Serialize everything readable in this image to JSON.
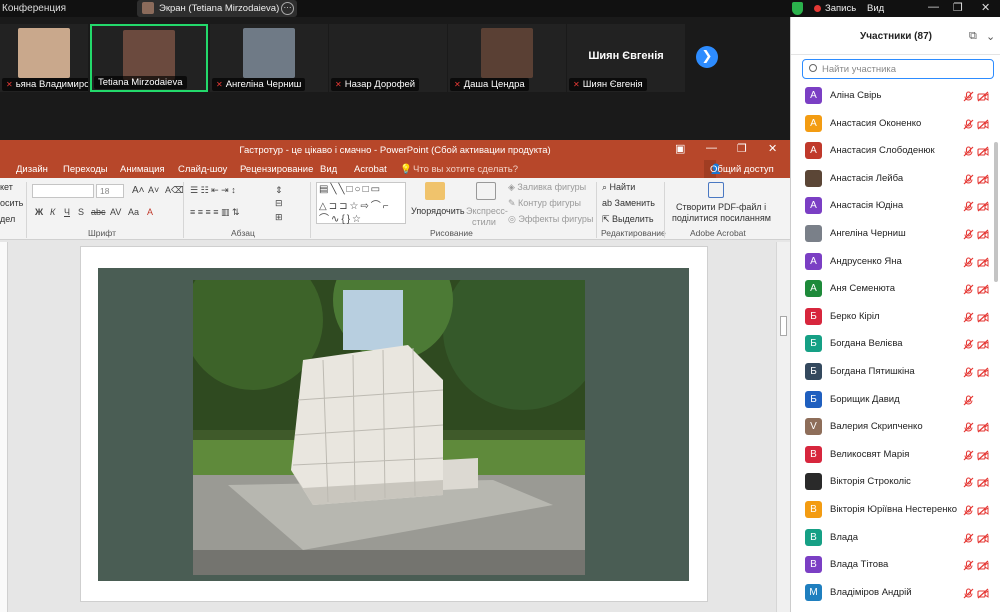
{
  "topbar": {
    "conference_label": "Конференция",
    "share_label": "Экран (Tetiana Mirzodaieva)",
    "record_label": "Запись",
    "view_label": "Вид"
  },
  "tiles": [
    {
      "name": "ьяна Владимировна",
      "photo_color": "#c9a88c"
    },
    {
      "name": "Tetiana Mirzodaieva",
      "photo_color": "#6b4a3e",
      "active": true
    },
    {
      "name": "Ангеліна Черниш",
      "photo_color": "#6f7a86"
    },
    {
      "name": "Назар Дорофей"
    },
    {
      "name": "Даша Цендра",
      "photo_color": "#5a4034"
    },
    {
      "name": "Шиян Євгенія",
      "display": "Шиян Євгенія"
    }
  ],
  "ppt": {
    "title": "Гастротур - це цікаво і смачно - PowerPoint (Сбой активации продукта)",
    "tabs": [
      "Дизайн",
      "Переходы",
      "Анимация",
      "Слайд-шоу",
      "Рецензирование",
      "Вид",
      "Acrobat"
    ],
    "tell_me": "Что вы хотите сделать?",
    "share": "Общий доступ",
    "groups": {
      "font": "Шрифт",
      "paragraph": "Абзац",
      "drawing": "Рисование",
      "editing": "Редактирование",
      "acrobat": "Adobe Acrobat"
    },
    "font_size": "18",
    "left_labels": [
      "кет",
      "осить",
      "дел"
    ],
    "arrange": "Упорядочить",
    "express": "Экспресс-",
    "styles": "стили",
    "shape_fill": "Заливка фигуры",
    "shape_outline": "Контур фигуры",
    "shape_effects": "Эффекты фигуры",
    "find": "Найти",
    "replace": "Заменить",
    "select": "Выделить",
    "pdf1": "Створити PDF-файл і",
    "pdf2": "поділитися посиланням"
  },
  "panel": {
    "title": "Участники (87)",
    "search_placeholder": "Найти участника",
    "participants": [
      {
        "initial": "А",
        "name": "Аліна Свірь",
        "color": "#7b3fc4"
      },
      {
        "initial": "А",
        "name": "Анастасия Оконенко",
        "color": "#f39c12"
      },
      {
        "initial": "А",
        "name": "Анастасия Слободенюк",
        "color": "#c0392b"
      },
      {
        "initial": "",
        "name": "Анастасія Лейба",
        "color": "#5b4636"
      },
      {
        "initial": "А",
        "name": "Анастасія Юдіна",
        "color": "#7b3fc4"
      },
      {
        "initial": "",
        "name": "Ангеліна Черниш",
        "color": "#7a8089"
      },
      {
        "initial": "А",
        "name": "Андрусенко Яна",
        "color": "#7b3fc4"
      },
      {
        "initial": "А",
        "name": "Аня Семенюта",
        "color": "#1e8a3a"
      },
      {
        "initial": "Б",
        "name": "Берко Кіріл",
        "color": "#d7263d"
      },
      {
        "initial": "Б",
        "name": "Богдана Велієва",
        "color": "#16a085"
      },
      {
        "initial": "Б",
        "name": "Богдана Пятишкіна",
        "color": "#34495e"
      },
      {
        "initial": "Б",
        "name": "Борищик Давид",
        "color": "#1f5fbf"
      },
      {
        "initial": "V",
        "name": "Валерия Скрипченко",
        "color": "#8e6e5a"
      },
      {
        "initial": "В",
        "name": "Великосвят Марія",
        "color": "#d7263d"
      },
      {
        "initial": "",
        "name": "Вікторія Строколіс",
        "color": "#2a2a2a"
      },
      {
        "initial": "В",
        "name": "Вікторія Юріївна Нестеренко",
        "color": "#f39c12"
      },
      {
        "initial": "В",
        "name": "Влада",
        "color": "#16a085"
      },
      {
        "initial": "В",
        "name": "Влада Тітова",
        "color": "#7b3fc4"
      },
      {
        "initial": "М",
        "name": "Владіміров Андрій",
        "color": "#1f7fbf"
      }
    ]
  }
}
